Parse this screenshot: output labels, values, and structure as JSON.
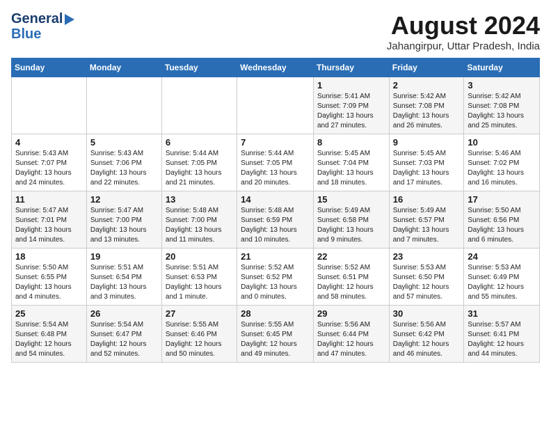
{
  "header": {
    "logo_general": "General",
    "logo_blue": "Blue",
    "title": "August 2024",
    "location": "Jahangirpur, Uttar Pradesh, India"
  },
  "days_of_week": [
    "Sunday",
    "Monday",
    "Tuesday",
    "Wednesday",
    "Thursday",
    "Friday",
    "Saturday"
  ],
  "weeks": [
    [
      {
        "day": "",
        "info": ""
      },
      {
        "day": "",
        "info": ""
      },
      {
        "day": "",
        "info": ""
      },
      {
        "day": "",
        "info": ""
      },
      {
        "day": "1",
        "info": "Sunrise: 5:41 AM\nSunset: 7:09 PM\nDaylight: 13 hours\nand 27 minutes."
      },
      {
        "day": "2",
        "info": "Sunrise: 5:42 AM\nSunset: 7:08 PM\nDaylight: 13 hours\nand 26 minutes."
      },
      {
        "day": "3",
        "info": "Sunrise: 5:42 AM\nSunset: 7:08 PM\nDaylight: 13 hours\nand 25 minutes."
      }
    ],
    [
      {
        "day": "4",
        "info": "Sunrise: 5:43 AM\nSunset: 7:07 PM\nDaylight: 13 hours\nand 24 minutes."
      },
      {
        "day": "5",
        "info": "Sunrise: 5:43 AM\nSunset: 7:06 PM\nDaylight: 13 hours\nand 22 minutes."
      },
      {
        "day": "6",
        "info": "Sunrise: 5:44 AM\nSunset: 7:05 PM\nDaylight: 13 hours\nand 21 minutes."
      },
      {
        "day": "7",
        "info": "Sunrise: 5:44 AM\nSunset: 7:05 PM\nDaylight: 13 hours\nand 20 minutes."
      },
      {
        "day": "8",
        "info": "Sunrise: 5:45 AM\nSunset: 7:04 PM\nDaylight: 13 hours\nand 18 minutes."
      },
      {
        "day": "9",
        "info": "Sunrise: 5:45 AM\nSunset: 7:03 PM\nDaylight: 13 hours\nand 17 minutes."
      },
      {
        "day": "10",
        "info": "Sunrise: 5:46 AM\nSunset: 7:02 PM\nDaylight: 13 hours\nand 16 minutes."
      }
    ],
    [
      {
        "day": "11",
        "info": "Sunrise: 5:47 AM\nSunset: 7:01 PM\nDaylight: 13 hours\nand 14 minutes."
      },
      {
        "day": "12",
        "info": "Sunrise: 5:47 AM\nSunset: 7:00 PM\nDaylight: 13 hours\nand 13 minutes."
      },
      {
        "day": "13",
        "info": "Sunrise: 5:48 AM\nSunset: 7:00 PM\nDaylight: 13 hours\nand 11 minutes."
      },
      {
        "day": "14",
        "info": "Sunrise: 5:48 AM\nSunset: 6:59 PM\nDaylight: 13 hours\nand 10 minutes."
      },
      {
        "day": "15",
        "info": "Sunrise: 5:49 AM\nSunset: 6:58 PM\nDaylight: 13 hours\nand 9 minutes."
      },
      {
        "day": "16",
        "info": "Sunrise: 5:49 AM\nSunset: 6:57 PM\nDaylight: 13 hours\nand 7 minutes."
      },
      {
        "day": "17",
        "info": "Sunrise: 5:50 AM\nSunset: 6:56 PM\nDaylight: 13 hours\nand 6 minutes."
      }
    ],
    [
      {
        "day": "18",
        "info": "Sunrise: 5:50 AM\nSunset: 6:55 PM\nDaylight: 13 hours\nand 4 minutes."
      },
      {
        "day": "19",
        "info": "Sunrise: 5:51 AM\nSunset: 6:54 PM\nDaylight: 13 hours\nand 3 minutes."
      },
      {
        "day": "20",
        "info": "Sunrise: 5:51 AM\nSunset: 6:53 PM\nDaylight: 13 hours\nand 1 minute."
      },
      {
        "day": "21",
        "info": "Sunrise: 5:52 AM\nSunset: 6:52 PM\nDaylight: 13 hours\nand 0 minutes."
      },
      {
        "day": "22",
        "info": "Sunrise: 5:52 AM\nSunset: 6:51 PM\nDaylight: 12 hours\nand 58 minutes."
      },
      {
        "day": "23",
        "info": "Sunrise: 5:53 AM\nSunset: 6:50 PM\nDaylight: 12 hours\nand 57 minutes."
      },
      {
        "day": "24",
        "info": "Sunrise: 5:53 AM\nSunset: 6:49 PM\nDaylight: 12 hours\nand 55 minutes."
      }
    ],
    [
      {
        "day": "25",
        "info": "Sunrise: 5:54 AM\nSunset: 6:48 PM\nDaylight: 12 hours\nand 54 minutes."
      },
      {
        "day": "26",
        "info": "Sunrise: 5:54 AM\nSunset: 6:47 PM\nDaylight: 12 hours\nand 52 minutes."
      },
      {
        "day": "27",
        "info": "Sunrise: 5:55 AM\nSunset: 6:46 PM\nDaylight: 12 hours\nand 50 minutes."
      },
      {
        "day": "28",
        "info": "Sunrise: 5:55 AM\nSunset: 6:45 PM\nDaylight: 12 hours\nand 49 minutes."
      },
      {
        "day": "29",
        "info": "Sunrise: 5:56 AM\nSunset: 6:44 PM\nDaylight: 12 hours\nand 47 minutes."
      },
      {
        "day": "30",
        "info": "Sunrise: 5:56 AM\nSunset: 6:42 PM\nDaylight: 12 hours\nand 46 minutes."
      },
      {
        "day": "31",
        "info": "Sunrise: 5:57 AM\nSunset: 6:41 PM\nDaylight: 12 hours\nand 44 minutes."
      }
    ]
  ]
}
